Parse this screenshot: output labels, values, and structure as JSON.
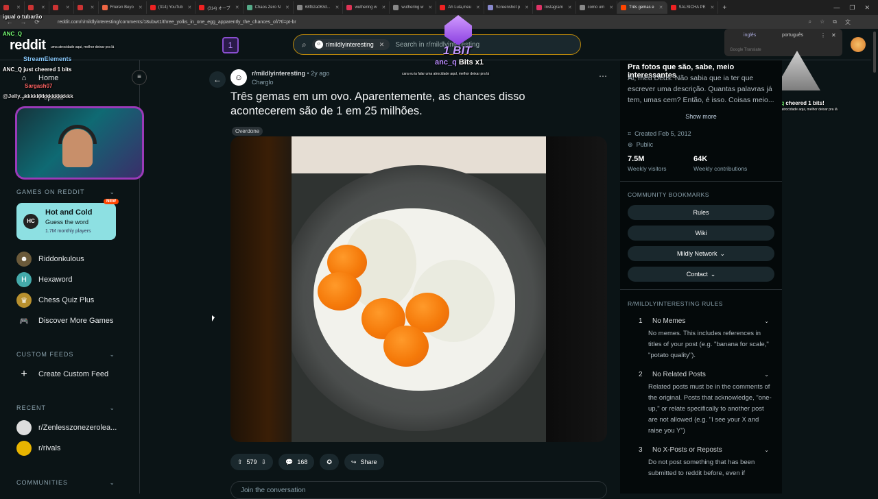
{
  "browser": {
    "tabs": [
      {
        "label": "",
        "color": "#c33"
      },
      {
        "label": "",
        "color": "#c33"
      },
      {
        "label": "",
        "color": "#c33"
      },
      {
        "label": "",
        "color": "#c33"
      },
      {
        "label": "Frieren Beyo",
        "color": "#e64"
      },
      {
        "label": "(314) YouTub",
        "color": "#e22"
      },
      {
        "label": "(314) オーブ",
        "color": "#e22"
      },
      {
        "label": "Chaos Zero N",
        "color": "#5a8"
      },
      {
        "label": "68fb2a063d...",
        "color": "#888"
      },
      {
        "label": "wuthering w",
        "color": "#d35"
      },
      {
        "label": "wuthering w",
        "color": "#888"
      },
      {
        "label": "Ah Lula,meu",
        "color": "#e22"
      },
      {
        "label": "Screenshot p",
        "color": "#88c"
      },
      {
        "label": "Instagram",
        "color": "#d36"
      },
      {
        "label": "como um",
        "color": "#888"
      },
      {
        "label": "Três gemas e",
        "color": "#ff4500"
      },
      {
        "label": "SALSICHA PE",
        "color": "#e22"
      }
    ],
    "url": "reddit.com/r/mildlyinteresting/comments/18ubwt1/three_yolks_in_one_egg_apparently_the_chances_of/?tl=pt-br"
  },
  "header": {
    "logo": "reddit",
    "community_chip": "r/mildlyinteresting",
    "search_placeholder": "Search in r/mildlyinteresting"
  },
  "translate_popup": {
    "lang1": "inglês",
    "lang2": "português",
    "footer": "Google Translate"
  },
  "stream_overlay": {
    "line1": "igual o tubarão",
    "user1": "ANC_Q",
    "user1_msg": "uma atrocidade aqui, melhor deixar pra lá",
    "elements": "StreamElements",
    "cheer": "ANC_Q just cheered 1 bits",
    "user2": "Sargash07",
    "user3": "@Jelly...kkkkkkkkkkkkkkkk",
    "bit_label": "1 BIT",
    "bits_line_user": "anc_q",
    "bits_line": "Bits x1",
    "caption": "cara eu ia falar uma atrocidade aquí, melhor deixar pra lá",
    "cheered_user": "anc_q",
    "cheered": "cheered 1 bits!",
    "cheered_caption": "cara eu ia falar uma atrocidade aqui, melhor deixar pra lá",
    "counter": "1"
  },
  "sidebar": {
    "home": "Home",
    "popular": "Popular",
    "games_head": "GAMES ON REDDIT",
    "featured_game": {
      "title": "Hot and Cold",
      "subtitle": "Guess the word",
      "players": "1.7M monthly players",
      "badge": "NEW",
      "icon_text": "HC"
    },
    "games": [
      {
        "label": "Riddonkulous",
        "icon": "donkey-icon",
        "color": "#6b5a3a"
      },
      {
        "label": "Hexaword",
        "icon": "hex-icon",
        "color": "#4aa"
      },
      {
        "label": "Chess Quiz Plus",
        "icon": "chess-icon",
        "color": "#b8902e"
      },
      {
        "label": "Discover More Games",
        "icon": "gamepad-icon",
        "color": "transparent"
      }
    ],
    "custom_feeds_head": "CUSTOM FEEDS",
    "create_feed": "Create Custom Feed",
    "recent_head": "RECENT",
    "recent": [
      {
        "label": "r/Zenlesszonezerolea...",
        "color": "#ddd"
      },
      {
        "label": "r/rivals",
        "color": "#e8b400"
      }
    ],
    "communities_head": "COMMUNITIES"
  },
  "post": {
    "subreddit": "r/mildlyinteresting",
    "age": "• 2y ago",
    "author": "Charglo",
    "title": "Três gemas em um ovo. Aparentemente, as chances disso acontecerem são de 1 em 25 milhões.",
    "flair": "Overdone",
    "votes": "579",
    "comments": "168",
    "share": "Share",
    "comment_placeholder": "Join the conversation"
  },
  "right_panel": {
    "heading": "Pra fotos que são, sabe, meio interessantes",
    "description": "Ai, meu Deus. Não sabia que ia ter que escrever uma descrição. Quantas palavras já tem, umas cem? Então, é isso. Coisas meio...",
    "show_more": "Show more",
    "created": "Created Feb 5, 2012",
    "visibility": "Public",
    "visitors_value": "7.5M",
    "visitors_label": "Weekly visitors",
    "contrib_value": "64K",
    "contrib_label": "Weekly contributions",
    "bookmarks_head": "COMMUNITY BOOKMARKS",
    "bookmarks": [
      "Rules",
      "Wiki",
      "Mildly Network",
      "Contact"
    ],
    "rules_head": "R/MILDLYINTERESTING RULES",
    "rules": [
      {
        "num": "1",
        "title": "No Memes",
        "desc": "No memes. This includes references in titles of your post (e.g. \"banana for scale,\" \"potato quality\")."
      },
      {
        "num": "2",
        "title": "No Related Posts",
        "desc": "Related posts must be in the comments of the original. Posts that acknowledge, \"one-up,\" or relate specifically to another post are not allowed (e.g. \"I see your X and raise you Y\")"
      },
      {
        "num": "3",
        "title": "No X-Posts or Reposts",
        "desc": "Do not post something that has been submitted to reddit before, even if"
      }
    ]
  }
}
